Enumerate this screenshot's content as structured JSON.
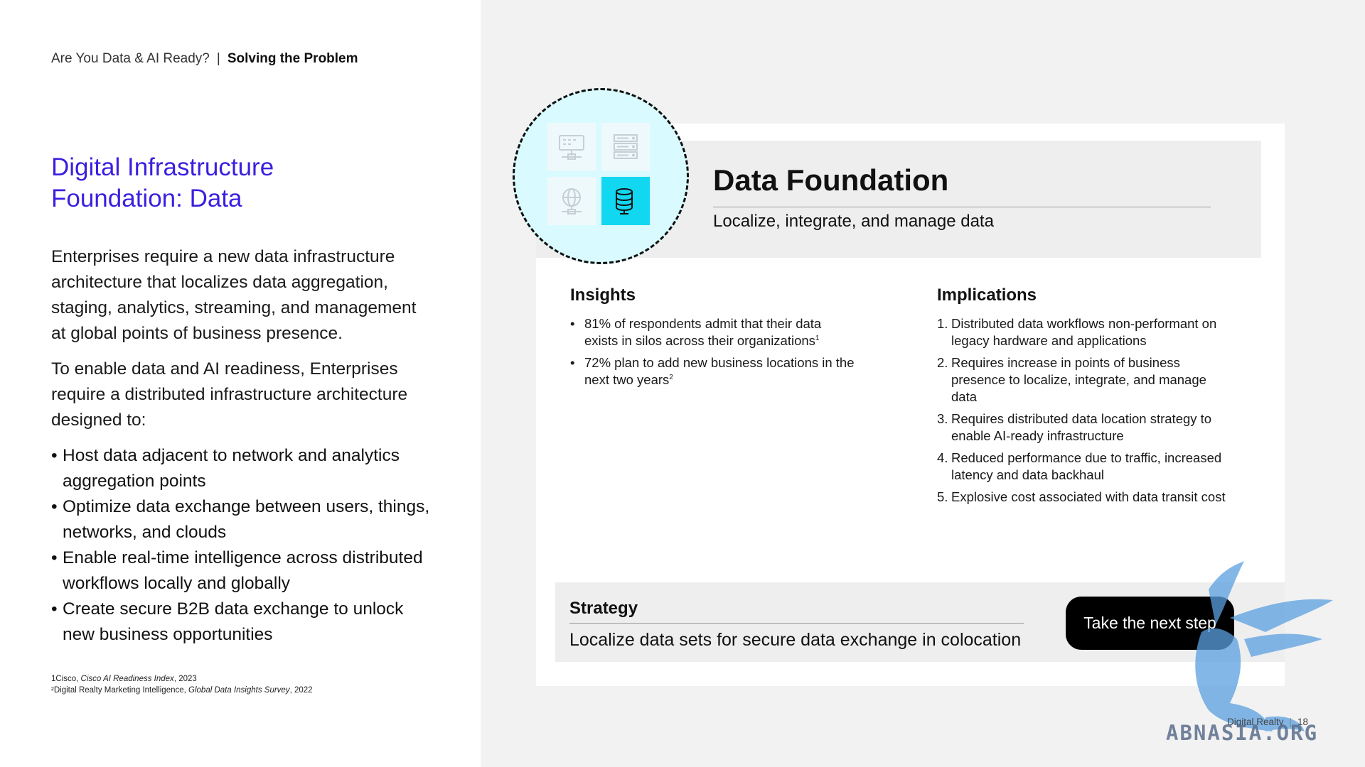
{
  "breadcrumb": {
    "section": "Are You Data & AI Ready?",
    "separator": "|",
    "current": "Solving the Problem"
  },
  "title": {
    "line1": "Digital Infrastructure",
    "line2": "Foundation: Data"
  },
  "intro": {
    "p1": "Enterprises require a new data infrastructure architecture that localizes data aggregation, staging, analytics, streaming, and management at global points of business presence.",
    "p2": "To enable data and AI readiness, Enterprises require a distributed infrastructure architecture designed to:",
    "bullets": [
      "Host data adjacent to network and analytics aggregation points",
      "Optimize data exchange between users, things, networks, and clouds",
      "Enable real-time intelligence across distributed workflows locally and globally",
      "Create secure B2B data exchange to unlock new business opportunities"
    ]
  },
  "footnotes": {
    "f1_prefix": "1Cisco, ",
    "f1_title": "Cisco AI Readiness Index",
    "f1_suffix": ", 2023",
    "f2_prefix": "²Digital Realty Marketing Intelligence, ",
    "f2_title": "Global Data Insights Survey",
    "f2_suffix": ", 2022"
  },
  "foundation": {
    "title": "Data Foundation",
    "subtitle": "Localize, integrate, and manage data",
    "icons": [
      "server-rack-icon",
      "server-stack-icon",
      "globe-network-icon",
      "database-icon"
    ],
    "accent": "#12d7f0",
    "circle_bg": "#d9fbff"
  },
  "insights": {
    "heading": "Insights",
    "items": [
      {
        "text": "81% of respondents admit that their data exists in silos across their organizations",
        "sup": "1"
      },
      {
        "text": "72% plan to add new business locations in the next two years",
        "sup": "2"
      }
    ]
  },
  "implications": {
    "heading": "Implications",
    "items": [
      {
        "num": "1.",
        "text": "Distributed data workflows non-performant on legacy hardware and applications"
      },
      {
        "num": "2.",
        "text": "Requires increase in points of business presence to localize, integrate, and manage data"
      },
      {
        "num": "3.",
        "text": "Requires distributed data location strategy to enable AI-ready infrastructure"
      },
      {
        "num": "4.",
        "text": "Reduced performance due to traffic, increased latency and data backhaul"
      },
      {
        "num": "5.",
        "text": "Explosive cost associated with data transit cost"
      }
    ]
  },
  "strategy": {
    "heading": "Strategy",
    "text": "Localize data sets for secure data exchange in colocation"
  },
  "cta": {
    "label": "Take the next step"
  },
  "footer": {
    "brand": "Digital Realty",
    "separator": "|",
    "page": "18"
  },
  "watermark": {
    "text": "ABNASIA.ORG",
    "color": "#5aa0e0"
  },
  "colors": {
    "title": "#3b1fe0",
    "panel": "#f2f2f2",
    "band": "#eeeeee"
  }
}
